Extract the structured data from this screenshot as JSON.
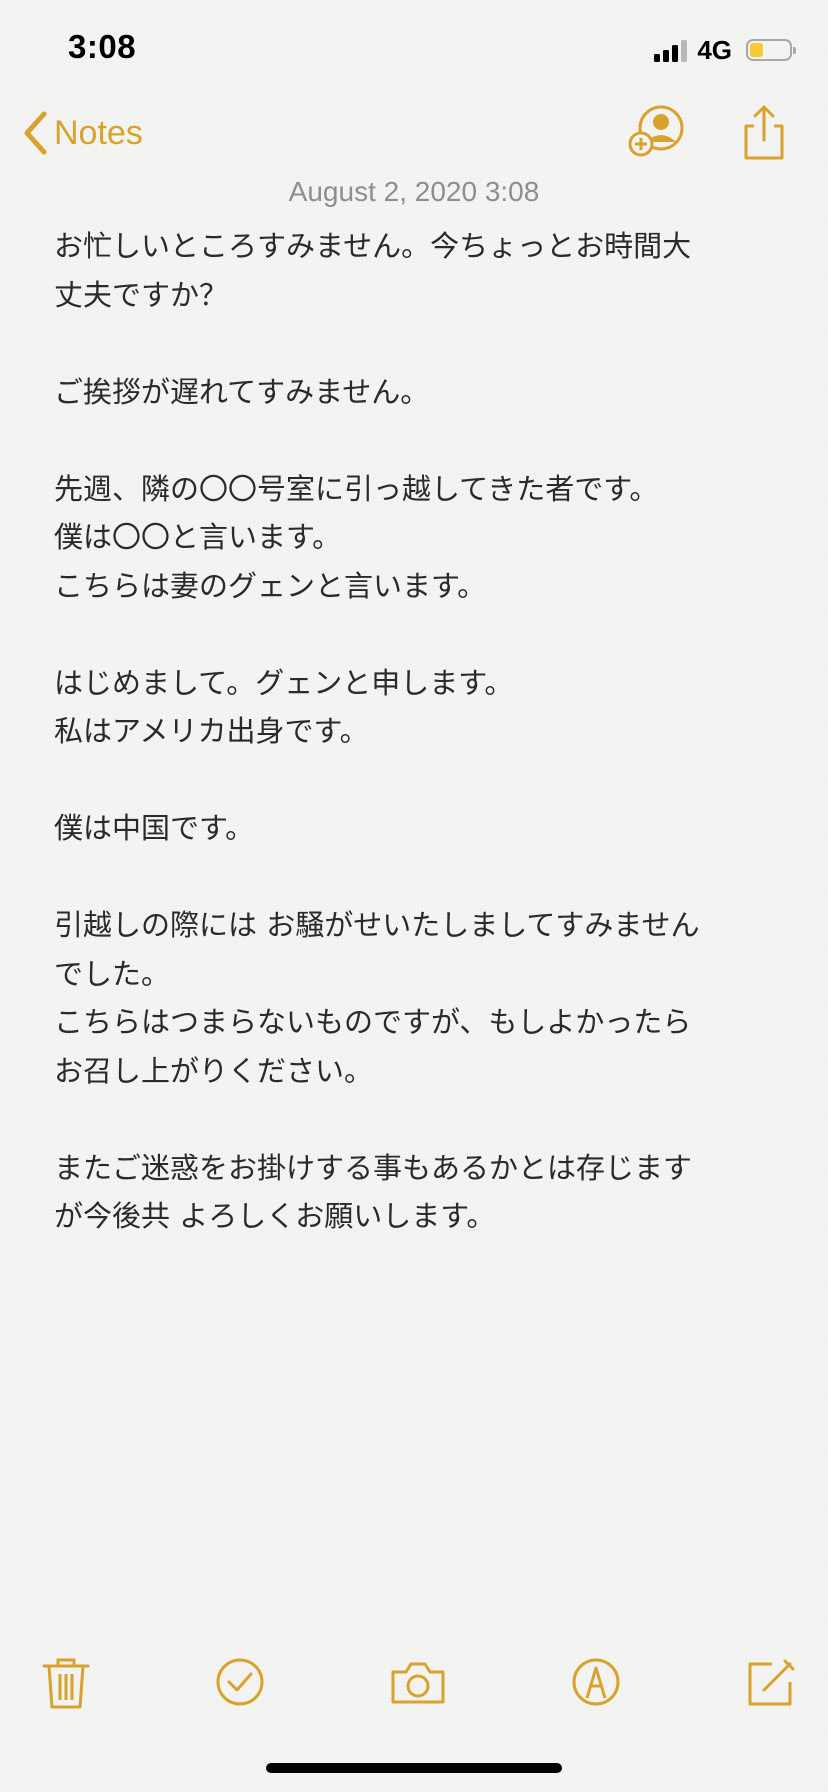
{
  "status_bar": {
    "time": "3:08",
    "network": "4G",
    "battery_level": 0.35,
    "signal_bars": 3
  },
  "nav": {
    "back_label": "Notes",
    "accent_color": "#d9a22c"
  },
  "note": {
    "date": "August 2, 2020 3:08",
    "lines": [
      "お忙しいところすみません。今ちょっとお時間大",
      "丈夫ですか？",
      "",
      "ご挨拶が遅れてすみません。",
      "",
      "先週、隣の〇〇号室に引っ越してきた者です。",
      "僕は〇〇と言います。",
      "こちらは妻のグェンと言います。",
      "",
      "はじめまして。グェンと申します。",
      "私はアメリカ出身です。",
      "",
      "僕は中国です。",
      "",
      "引越しの際には お騒がせいたしましてすみません",
      "でした。",
      "こちらはつまらないものですが、もしよかったら",
      "お召し上がりください。",
      "",
      "またご迷惑をお掛けする事もあるかとは存じます",
      "が今後共 よろしくお願いします。"
    ]
  },
  "toolbar": {
    "icons": [
      "trash-icon",
      "checklist-icon",
      "camera-icon",
      "markup-icon",
      "compose-icon"
    ]
  }
}
